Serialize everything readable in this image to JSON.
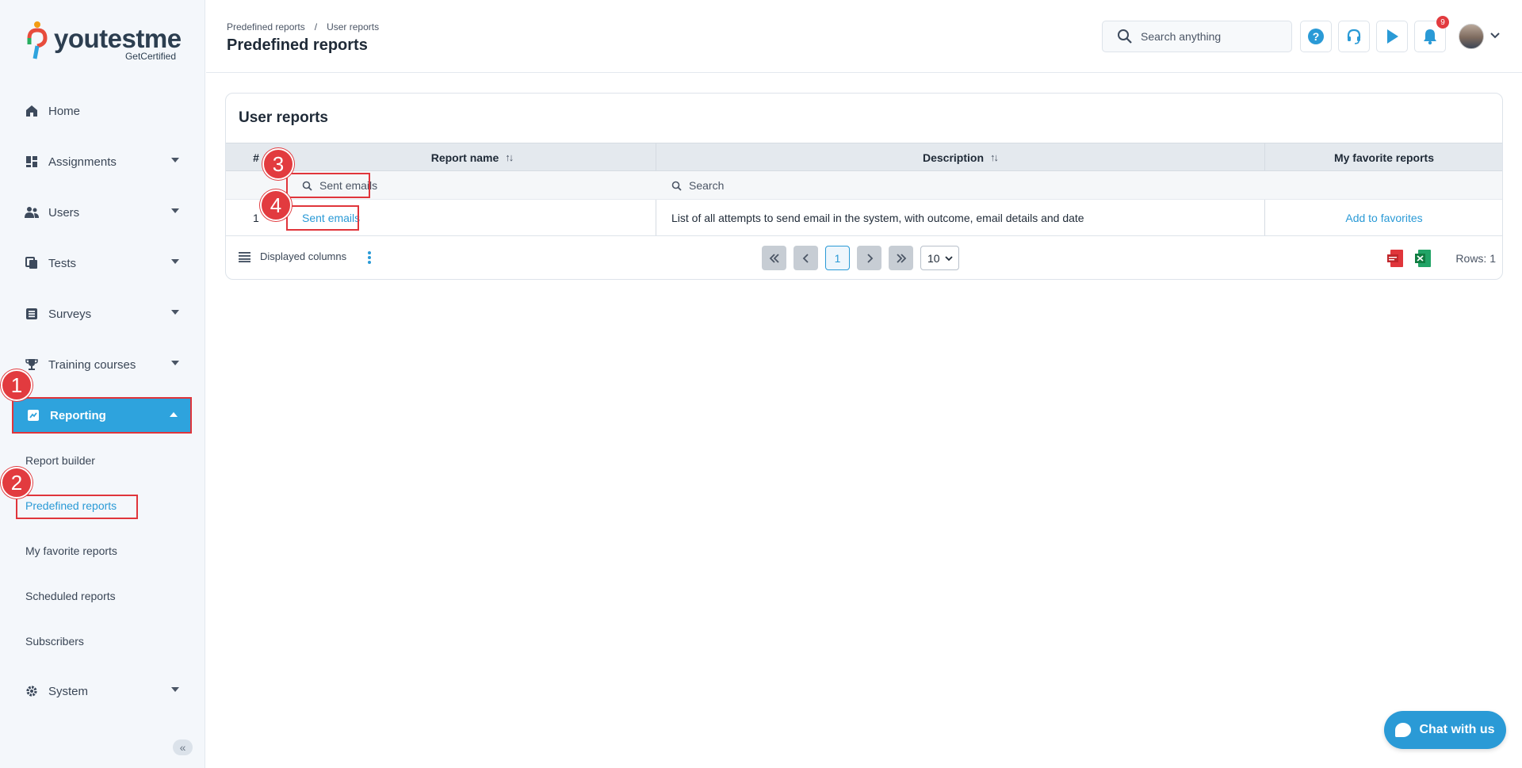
{
  "brand": {
    "logo_part1": "youtest",
    "logo_part2": "me",
    "logo_sub": "GetCertified",
    "accent_color": "#2ea3dd",
    "annotation_color": "#e0353b"
  },
  "sidebar": {
    "items": [
      {
        "label": "Home",
        "icon": "home-icon"
      },
      {
        "label": "Assignments",
        "icon": "dashboard-icon"
      },
      {
        "label": "Users",
        "icon": "users-icon"
      },
      {
        "label": "Tests",
        "icon": "tests-icon"
      },
      {
        "label": "Surveys",
        "icon": "surveys-icon"
      },
      {
        "label": "Training courses",
        "icon": "trophy-icon"
      },
      {
        "label": "Reporting",
        "icon": "reporting-icon"
      },
      {
        "label": "System",
        "icon": "gear-icon"
      }
    ],
    "reporting_sub": [
      {
        "label": "Report builder"
      },
      {
        "label": "Predefined reports"
      },
      {
        "label": "My favorite reports"
      },
      {
        "label": "Scheduled reports"
      },
      {
        "label": "Subscribers"
      }
    ],
    "collapse_label": "«"
  },
  "annotations": [
    "1",
    "2",
    "3",
    "4"
  ],
  "header": {
    "breadcrumb": [
      "Predefined reports",
      "/",
      "User reports"
    ],
    "title": "Predefined reports",
    "search_placeholder": "Search anything",
    "notification_count": "9"
  },
  "card": {
    "title": "User reports",
    "columns": {
      "index": "#",
      "report_name": "Report name",
      "description": "Description",
      "favorites": "My favorite reports",
      "sort_glyph": "↑↓"
    },
    "filters": {
      "report_name_value": "Sent emails",
      "description_placeholder": "Search"
    },
    "rows": [
      {
        "index": "1",
        "report_name": "Sent emails",
        "description": "List of all attempts to send email in the system, with outcome, email details and date",
        "action": "Add to favorites"
      }
    ],
    "footer": {
      "displayed_columns": "Displayed columns",
      "current_page": "1",
      "rows_per_page": "10",
      "rows_count": "Rows: 1"
    }
  },
  "chat": {
    "label": "Chat with us"
  }
}
